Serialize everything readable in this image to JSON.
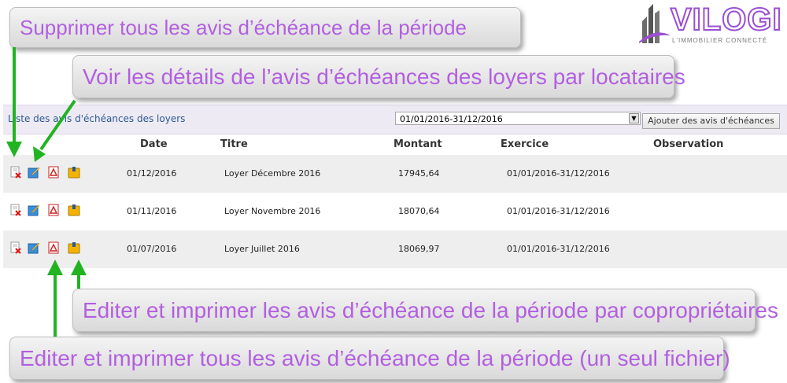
{
  "callouts": {
    "delete_all": "Supprimer tous les avis d’échéance de la période",
    "view_details": "Voir les détails de l’avis d’échéances des loyers par locataires",
    "print_by_owner": "Editer et imprimer les avis d’échéance de la période par copropriétaires",
    "print_all_single": "Editer et imprimer tous les avis d’échéance de la période (un seul fichier)"
  },
  "logo": {
    "text": "VILOGI",
    "tagline": "L'IMMOBILIER CONNECTÉ",
    "color": "#9a4fd1"
  },
  "panel": {
    "title": "Liste des avis d'échéances des loyers",
    "period_selected": "01/01/2016-31/12/2016",
    "add_button": "Ajouter des avis d'échéances"
  },
  "table": {
    "headers": {
      "date": "Date",
      "titre": "Titre",
      "montant": "Montant",
      "exercice": "Exercice",
      "observation": "Observation"
    },
    "rows": [
      {
        "date": "01/12/2016",
        "titre": "Loyer Décembre 2016",
        "montant": "17945,64",
        "exercice": "01/01/2016-31/12/2016",
        "observation": ""
      },
      {
        "date": "01/11/2016",
        "titre": "Loyer Novembre 2016",
        "montant": "18070,64",
        "exercice": "01/01/2016-31/12/2016",
        "observation": ""
      },
      {
        "date": "01/07/2016",
        "titre": "Loyer Juillet 2016",
        "montant": "18069,97",
        "exercice": "01/01/2016-31/12/2016",
        "observation": ""
      }
    ],
    "row_icons": [
      "delete-document-icon",
      "edit-icon",
      "pdf-icon",
      "print-binder-icon"
    ]
  },
  "colors": {
    "callout_text": "#b25fe0",
    "arrow": "#22b322",
    "header_bg": "#eeeaf4",
    "title": "#2a5a8f"
  }
}
